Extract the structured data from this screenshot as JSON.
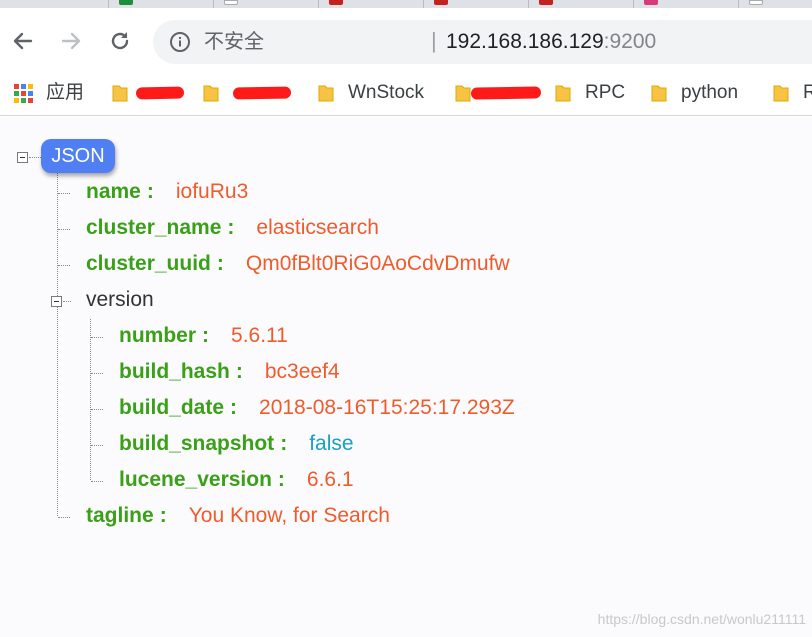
{
  "browser": {
    "security_label": "不安全",
    "separator": "|",
    "url_host": "192.168.186.129",
    "url_port": ":9200"
  },
  "bookmarks": {
    "apps_label": "应用",
    "items": [
      {
        "label": ""
      },
      {
        "label": ""
      },
      {
        "label": "WnStock"
      },
      {
        "label": ""
      },
      {
        "label": "RPC"
      },
      {
        "label": "python"
      },
      {
        "label": "R"
      }
    ]
  },
  "json_viewer": {
    "root_label": "JSON",
    "rows": [
      {
        "key": "name",
        "value": "iofuRu3"
      },
      {
        "key": "cluster_name",
        "value": "elasticsearch"
      },
      {
        "key": "cluster_uuid",
        "value": "Qm0fBlt0RiG0AoCdvDmufw"
      },
      {
        "key": "version"
      },
      {
        "key": "number",
        "value": "5.6.11"
      },
      {
        "key": "build_hash",
        "value": "bc3eef4"
      },
      {
        "key": "build_date",
        "value": "2018-08-16T15:25:17.293Z"
      },
      {
        "key": "build_snapshot",
        "value": "false"
      },
      {
        "key": "lucene_version",
        "value": "6.6.1"
      },
      {
        "key": "tagline",
        "value": "You Know, for Search"
      }
    ]
  },
  "watermark": "https://blog.csdn.net/wonlu211111",
  "colors": {
    "key": "#3aa017",
    "string_value": "#f05b2c",
    "boolean_value": "#1a9fc5",
    "root_pill": "#4f7ff2",
    "redaction": "#ff1a1a"
  }
}
